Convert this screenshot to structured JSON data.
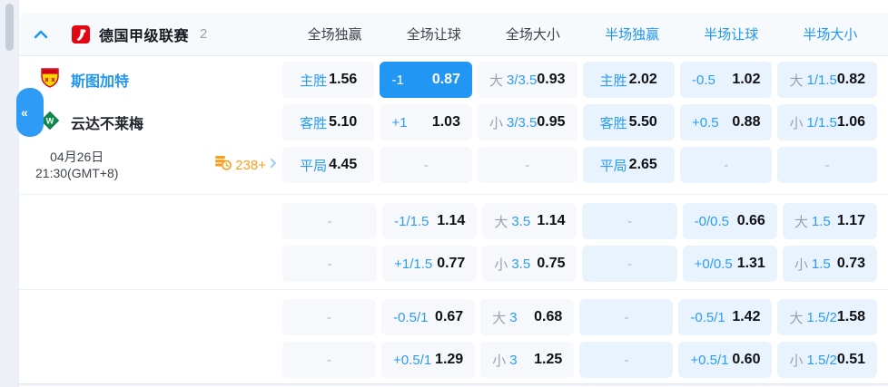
{
  "colors": {
    "accent": "#2196f3",
    "selected_cell_bg": "#2196f3",
    "full_cell_bg": "#f6f8fb",
    "half_cell_bg": "#e9f3fe",
    "label_blue": "#2b9cf8",
    "ou_prefix_gray": "#9aa0ab",
    "value_dark": "#101114",
    "count_orange": "#ff9e1b"
  },
  "icons": {
    "collapse": "chevron-up",
    "sidebar_collapse_glyph": "«",
    "league_logo": "bundesliga-logo",
    "home_logo": "stuttgart-crest",
    "away_logo": "bremen-crest",
    "markets": "coins-clock",
    "more_chevron_glyph": "›"
  },
  "header": {
    "league": "德国甲级联赛",
    "match_count": "2",
    "columns": [
      {
        "label": "全场独赢",
        "half": false
      },
      {
        "label": "全场让球",
        "half": false
      },
      {
        "label": "全场大小",
        "half": false
      },
      {
        "label": "半场独赢",
        "half": true
      },
      {
        "label": "半场让球",
        "half": true
      },
      {
        "label": "半场大小",
        "half": true
      }
    ]
  },
  "match": {
    "home_team": "斯图加特",
    "away_team": "云达不莱梅",
    "date": "04月26日",
    "time": "21:30(GMT+8)",
    "more_markets": "238+"
  },
  "odds": {
    "groups": [
      {
        "rows": [
          [
            {
              "label": "主胜",
              "value": "1.56"
            },
            {
              "hcp": "-1",
              "value": "0.87",
              "sel": true
            },
            {
              "ou": "大",
              "line": "3/3.5",
              "value": "0.93"
            },
            {
              "label": "主胜",
              "value": "2.02"
            },
            {
              "hcp": "-0.5",
              "value": "1.02"
            },
            {
              "ou": "大",
              "line": "1/1.5",
              "value": "0.82"
            }
          ],
          [
            {
              "label": "客胜",
              "value": "5.10"
            },
            {
              "hcp": "+1",
              "value": "1.03"
            },
            {
              "ou": "小",
              "line": "3/3.5",
              "value": "0.95"
            },
            {
              "label": "客胜",
              "value": "5.50"
            },
            {
              "hcp": "+0.5",
              "value": "0.88"
            },
            {
              "ou": "小",
              "line": "1/1.5",
              "value": "1.06"
            }
          ],
          [
            {
              "label": "平局",
              "value": "4.45"
            },
            {
              "dash": "-"
            },
            {
              "dash": "-"
            },
            {
              "label": "平局",
              "value": "2.65"
            },
            {
              "dash": "-"
            },
            {
              "dash": "-"
            }
          ]
        ]
      },
      {
        "rows": [
          [
            {
              "dash": "-"
            },
            {
              "hcp": "-1/1.5",
              "value": "1.14"
            },
            {
              "ou": "大",
              "line": "3.5",
              "value": "1.14"
            },
            {
              "dash": "-"
            },
            {
              "hcp": "-0/0.5",
              "value": "0.66"
            },
            {
              "ou": "大",
              "line": "1.5",
              "value": "1.17"
            }
          ],
          [
            {
              "dash": "-"
            },
            {
              "hcp": "+1/1.5",
              "value": "0.77"
            },
            {
              "ou": "小",
              "line": "3.5",
              "value": "0.75"
            },
            {
              "dash": "-"
            },
            {
              "hcp": "+0/0.5",
              "value": "1.31"
            },
            {
              "ou": "小",
              "line": "1.5",
              "value": "0.73"
            }
          ]
        ]
      },
      {
        "rows": [
          [
            {
              "dash": "-"
            },
            {
              "hcp": "-0.5/1",
              "value": "0.67"
            },
            {
              "ou": "大",
              "line": "3",
              "value": "0.68"
            },
            {
              "dash": "-"
            },
            {
              "hcp": "-0.5/1",
              "value": "1.42"
            },
            {
              "ou": "大",
              "line": "1.5/2",
              "value": "1.58"
            }
          ],
          [
            {
              "dash": "-"
            },
            {
              "hcp": "+0.5/1",
              "value": "1.29"
            },
            {
              "ou": "小",
              "line": "3",
              "value": "1.25"
            },
            {
              "dash": "-"
            },
            {
              "hcp": "+0.5/1",
              "value": "0.60"
            },
            {
              "ou": "小",
              "line": "1.5/2",
              "value": "0.51"
            }
          ]
        ]
      }
    ]
  }
}
